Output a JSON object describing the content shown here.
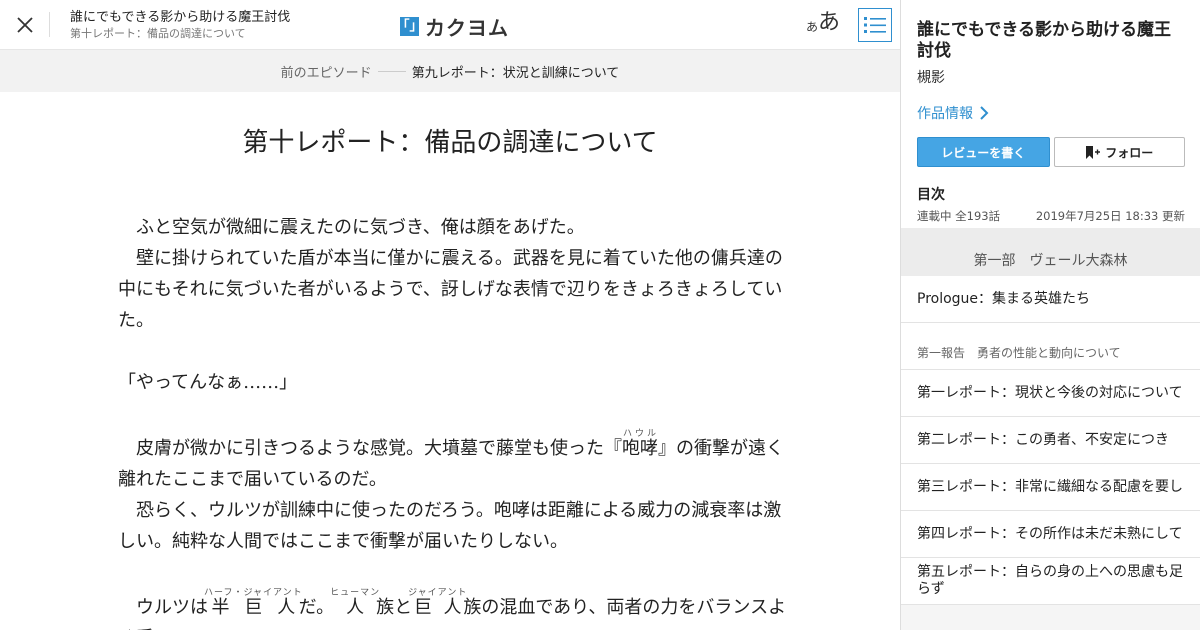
{
  "header": {
    "work_title": "誰にでもできる影から助ける魔王討伐",
    "episode_title": "第十レポート：備品の調達について",
    "logo_mark": "「」",
    "logo_text": "カクヨム",
    "font_small": "あ",
    "font_large": "あ"
  },
  "nav": {
    "prev_label": "前のエピソード",
    "prev_title": "第九レポート：状況と訓練について"
  },
  "episode": {
    "title": "第十レポート：備品の調達について",
    "p1": "　ふと空気が微細に震えたのに気づき、俺は顔をあげた。",
    "p2": "　壁に掛けられていた盾が本当に僅かに震える。武器を見に着ていた他の傭兵達の中にもそれに気づいた者がいるようで、訝しげな表情で辺りをきょろきょろしていた。",
    "p3": "「やってんなぁ……」",
    "p4_before": "　皮膚が微かに引きつるような感覚。大墳墓で藤堂も使った『",
    "p4_ruby": "咆哮",
    "p4_rt": "ハウル",
    "p4_after": "』の衝撃が遠く離れたここまで届いているのだ。",
    "p5": "　恐らく、ウルツが訓練中に使ったのだろう。咆哮は距離による威力の減衰率は激しい。純粋な人間ではここまで衝撃が届いたりしない。",
    "p6_a": "　ウルツは",
    "p6_r1": "半巨人",
    "p6_rt1": "ハーフ・ジャイアント",
    "p6_b": "だ。",
    "p6_r2": "人",
    "p6_rt2": "ヒューマン",
    "p6_c": "族と",
    "p6_r3": "巨人",
    "p6_rt3": "ジャイアント",
    "p6_d": "族の混血であり、両者の力をバランスよく受"
  },
  "sidebar": {
    "title": "誰にでもできる影から助ける魔王討伐",
    "author": "槻影",
    "info_link": "作品情報",
    "review_button": "レビューを書く",
    "follow_button": "フォロー",
    "toc_heading": "目次",
    "status": "連載中 全193話",
    "updated": "2019年7月25日 18:33 更新",
    "part_title": "第一部　ヴェール大森林",
    "prologue": "Prologue：集まる英雄たち",
    "section_title": "第一報告　勇者の性能と動向について",
    "items": [
      "第一レポート：現状と今後の対応について",
      "第二レポート：この勇者、不安定につき",
      "第三レポート：非常に繊細なる配慮を要し",
      "第四レポート：その所作は未だ未熟にして",
      "第五レポート：自らの身の上への思慮も足らず"
    ]
  },
  "colors": {
    "accent": "#2f8fcf",
    "review_button_bg": "#45a5e4"
  }
}
